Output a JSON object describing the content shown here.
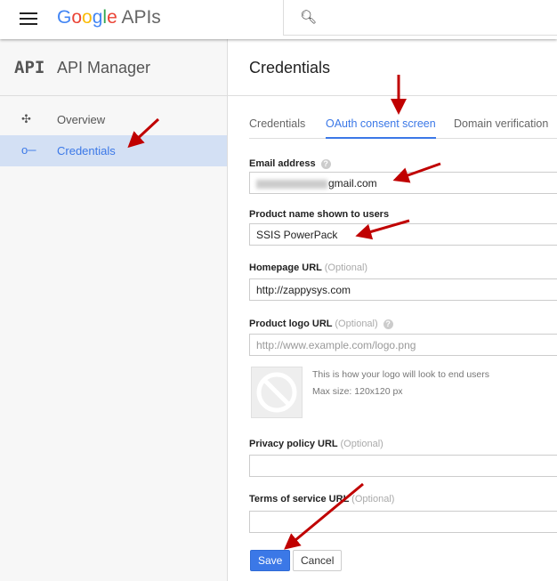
{
  "topbar": {
    "brand": "Google",
    "product": "APIs"
  },
  "sidebar": {
    "logo": "API",
    "title": "API Manager",
    "items": [
      {
        "label": "Overview",
        "icon": "overview-icon"
      },
      {
        "label": "Credentials",
        "icon": "key-icon",
        "active": true
      }
    ]
  },
  "main": {
    "title": "Credentials",
    "tabs": [
      {
        "label": "Credentials"
      },
      {
        "label": "OAuth consent screen",
        "active": true
      },
      {
        "label": "Domain verification"
      }
    ],
    "form": {
      "email": {
        "label": "Email address",
        "value": "gmail.com"
      },
      "product_name": {
        "label": "Product name shown to users",
        "value": "SSIS PowerPack"
      },
      "homepage": {
        "label": "Homepage URL",
        "optional": "(Optional)",
        "value": "http://zappysys.com"
      },
      "logo_url": {
        "label": "Product logo URL",
        "optional": "(Optional)",
        "placeholder": "http://www.example.com/logo.png"
      },
      "logo_note": "This is how your logo will look to end users",
      "logo_size": "Max size: 120x120 px",
      "privacy": {
        "label": "Privacy policy URL",
        "optional": "(Optional)",
        "value": ""
      },
      "terms": {
        "label": "Terms of service URL",
        "optional": "(Optional)",
        "value": ""
      }
    },
    "buttons": {
      "save": "Save",
      "cancel": "Cancel"
    }
  },
  "colors": {
    "accent": "#3b78e7",
    "active_bg": "#d3e0f4",
    "annotation_arrow": "#c00000"
  }
}
